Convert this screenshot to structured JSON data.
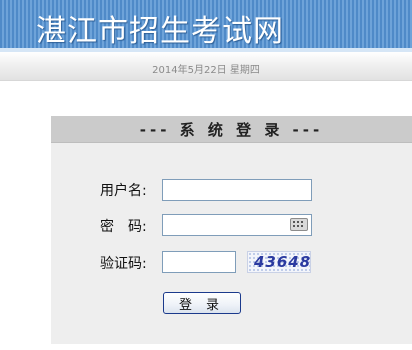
{
  "header": {
    "site_title": "湛江市招生考试网",
    "date_text": "2014年5月22日 星期四"
  },
  "login": {
    "panel_title": "--- 系 统 登 录 ---",
    "username_label": "用户名:",
    "username_value": "",
    "password_label": "密　码:",
    "password_value": "",
    "captcha_label": "验证码:",
    "captcha_value": "",
    "captcha_image_text": "43648",
    "submit_label": "登录"
  }
}
